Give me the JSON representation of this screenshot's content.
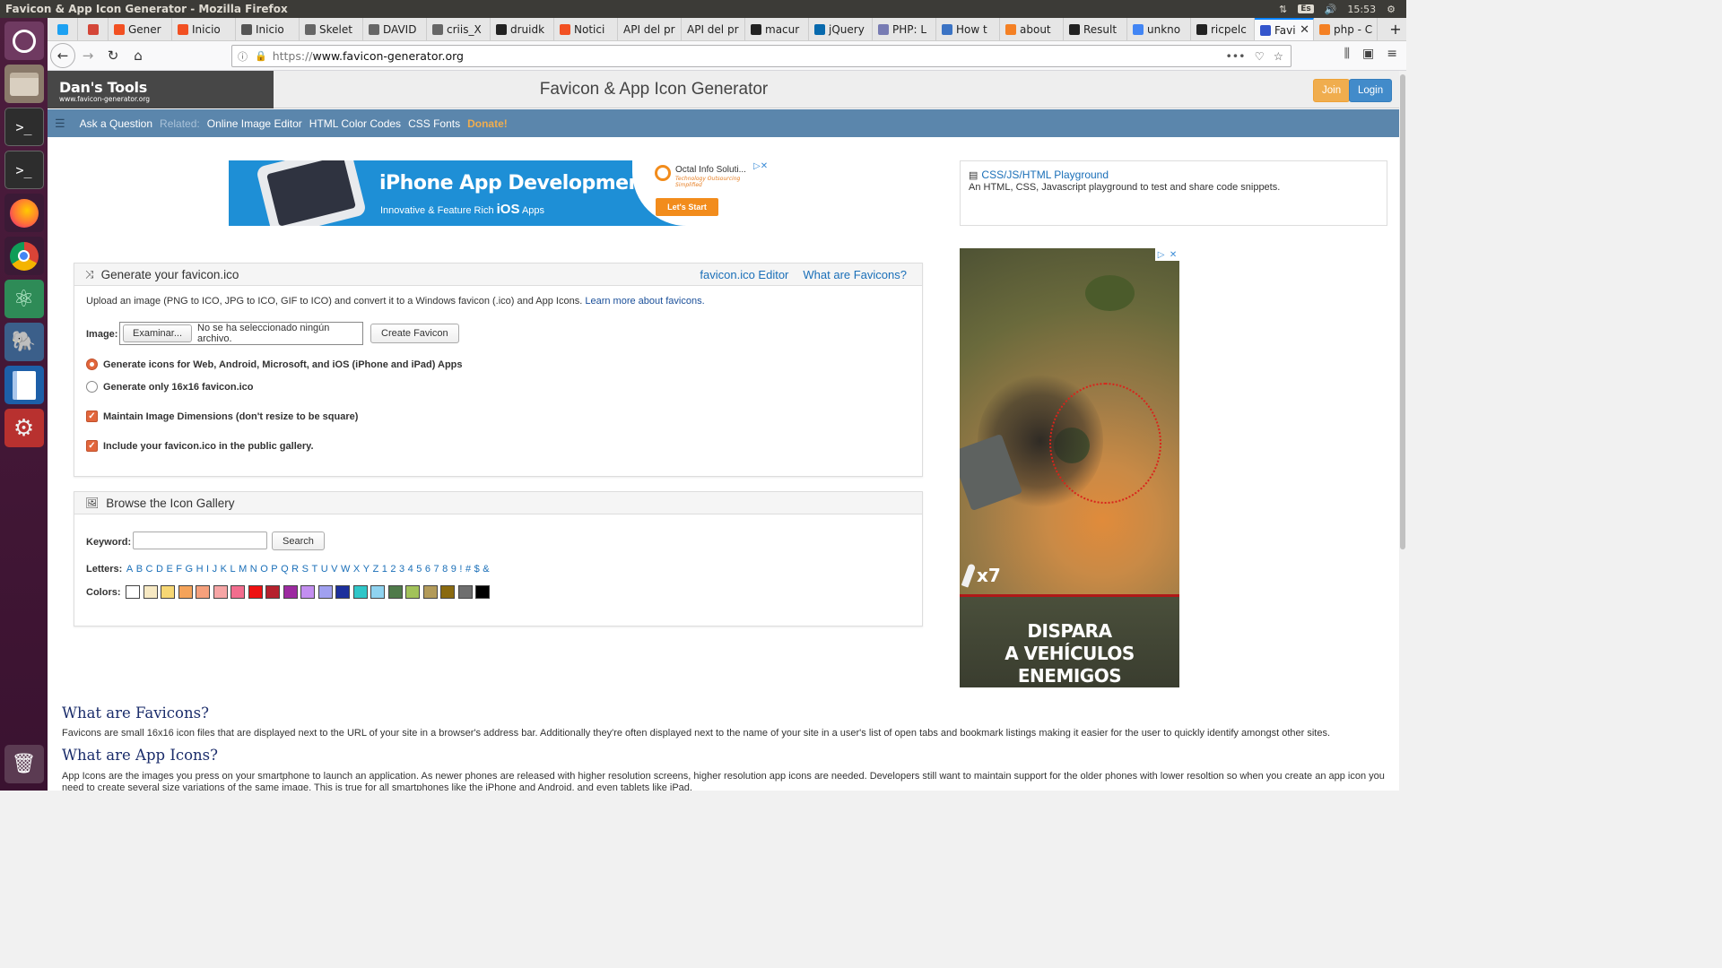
{
  "window": {
    "title": "Favicon & App Icon Generator - Mozilla Firefox",
    "keyboard_layout": "Es",
    "clock": "15:53"
  },
  "launcher": {
    "items": [
      "ubuntu-dash",
      "files",
      "terminal",
      "terminal-2",
      "firefox",
      "chrome",
      "atom",
      "postgresql",
      "libreoffice-writer",
      "system-settings",
      "trash"
    ]
  },
  "tabs": [
    {
      "label": "",
      "icon": "twitter-icon",
      "color": "#1da1f2",
      "pinned": true
    },
    {
      "label": "",
      "icon": "gmail-icon",
      "color": "#d44638",
      "pinned": true
    },
    {
      "label": "Gener",
      "icon": "grid-icon",
      "color": "#f25022"
    },
    {
      "label": "Inicio",
      "icon": "grid-icon",
      "color": "#f25022"
    },
    {
      "label": "Inicio",
      "icon": "page-icon",
      "color": "#555555"
    },
    {
      "label": "Skelet",
      "icon": "page-icon",
      "color": "#666666"
    },
    {
      "label": "DAVID",
      "icon": "page-icon",
      "color": "#666666"
    },
    {
      "label": "criis_X",
      "icon": "page-icon",
      "color": "#666666"
    },
    {
      "label": "druidk",
      "icon": "github-icon",
      "color": "#222222"
    },
    {
      "label": "Notici",
      "icon": "grid-icon",
      "color": "#f25022"
    },
    {
      "label": "API del pr",
      "icon": "",
      "color": ""
    },
    {
      "label": "API del pr",
      "icon": "",
      "color": ""
    },
    {
      "label": "macur",
      "icon": "github-icon",
      "color": "#222222"
    },
    {
      "label": "jQuery",
      "icon": "jquery-icon",
      "color": "#0769ad"
    },
    {
      "label": "PHP: L",
      "icon": "php-icon",
      "color": "#777bb3"
    },
    {
      "label": "How t",
      "icon": "page-icon",
      "color": "#3b73c4"
    },
    {
      "label": "about",
      "icon": "stack-icon",
      "color": "#f48024"
    },
    {
      "label": "Result",
      "icon": "page-icon",
      "color": "#222222"
    },
    {
      "label": "unkno",
      "icon": "google-icon",
      "color": "#4285f4"
    },
    {
      "label": "ricpelc",
      "icon": "github-icon",
      "color": "#222222"
    },
    {
      "label": "Favi",
      "icon": "favicon-icon",
      "color": "#3355cc",
      "active": true
    },
    {
      "label": "php - C",
      "icon": "stack-icon",
      "color": "#f48024"
    }
  ],
  "address_bar": {
    "scheme": "https://",
    "host": "www.favicon-generator.org"
  },
  "site": {
    "brand_name": "Dan's Tools",
    "brand_url": "www.favicon-generator.org",
    "title": "Favicon & App Icon Generator",
    "join_label": "Join",
    "login_label": "Login"
  },
  "subnav": {
    "ask": "Ask a Question",
    "related": "Related:",
    "links": [
      "Online Image Editor",
      "HTML Color Codes",
      "CSS Fonts"
    ],
    "donate": "Donate!"
  },
  "ad_top": {
    "headline": "iPhone App Development",
    "sub_prefix": "Innovative & Feature Rich",
    "sub_bold": "iOS",
    "sub_suffix": "Apps",
    "brand": "Octal Info Soluti...",
    "tagline": "Technology Outsourcing Simplified",
    "cta": "Let's Start"
  },
  "playground": {
    "title": "CSS/JS/HTML Playground",
    "desc": "An HTML, CSS, Javascript playground to test and share code snippets."
  },
  "generate": {
    "title": "Generate your favicon.ico",
    "editor_link": "favicon.ico Editor",
    "what_link": "What are Favicons?",
    "desc": "Upload an image (PNG to ICO, JPG to ICO, GIF to ICO) and convert it to a Windows favicon (.ico) and App Icons.",
    "learn_more": "Learn more about favicons.",
    "image_label": "Image:",
    "browse_label": "Examinar...",
    "no_file": "No se ha seleccionado ningún archivo.",
    "create_label": "Create Favicon",
    "opt_all": "Generate icons for Web, Android, Microsoft, and iOS (iPhone and iPad) Apps",
    "opt_16": "Generate only 16x16 favicon.ico",
    "opt_dims": "Maintain Image Dimensions (don't resize to be square)",
    "opt_gallery": "Include your favicon.ico in the public gallery."
  },
  "gallery": {
    "title": "Browse the Icon Gallery",
    "keyword_label": "Keyword:",
    "keyword_value": "",
    "search_label": "Search",
    "letters_label": "Letters:",
    "letters": [
      "A",
      "B",
      "C",
      "D",
      "E",
      "F",
      "G",
      "H",
      "I",
      "J",
      "K",
      "L",
      "M",
      "N",
      "O",
      "P",
      "Q",
      "R",
      "S",
      "T",
      "U",
      "V",
      "W",
      "X",
      "Y",
      "Z",
      "1",
      "2",
      "3",
      "4",
      "5",
      "6",
      "7",
      "8",
      "9",
      "!",
      "#",
      "$",
      "&"
    ],
    "colors_label": "Colors:",
    "colors": [
      "#ffffff",
      "#f7e9c3",
      "#f7d774",
      "#f4a35a",
      "#f5a07c",
      "#f6a5a5",
      "#f26d8e",
      "#ee1111",
      "#b5212d",
      "#9c2aa0",
      "#c38ef0",
      "#a0a0f0",
      "#1c2f9c",
      "#30c6c8",
      "#8fd3f0",
      "#4f7a4a",
      "#a2c25a",
      "#b39b5a",
      "#8a6a10",
      "#6e6e6e",
      "#000000"
    ]
  },
  "ad_side": {
    "ammo": "x7",
    "line1": "DISPARA",
    "line2": "A VEHÍCULOS ENEMIGOS"
  },
  "faq": {
    "h1": "What are Favicons?",
    "p1": "Favicons are small 16x16 icon files that are displayed next to the URL of your site in a browser's address bar. Additionally they're often displayed next to the name of your site in a user's list of open tabs and bookmark listings making it easier for the user to quickly identify amongst other sites.",
    "h2": "What are App Icons?",
    "p2": "App Icons are the images you press on your smartphone to launch an application. As newer phones are released with higher resolution screens, higher resolution app icons are needed. Developers still want to maintain support for the older phones with lower resoltion so when you create an app icon you need to create several size variations of the same image. This is true for all smartphones like the iPhone and Android, and even tablets like iPad."
  }
}
